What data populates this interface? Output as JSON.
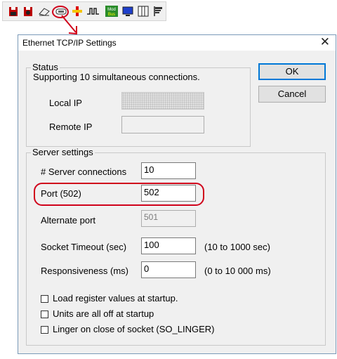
{
  "toolbar": {
    "icons": [
      "save-icon",
      "open-icon",
      "eraser-icon",
      "ethernet-port-icon",
      "add-device-icon",
      "signal-icon",
      "modbus-icon",
      "monitor-icon",
      "columns-icon",
      "flag-icon"
    ],
    "modbus_badge_text": "Mod Bus"
  },
  "dialog": {
    "title": "Ethernet TCP/IP Settings",
    "close_glyph": "✕",
    "ok_label": "OK",
    "cancel_label": "Cancel",
    "status": {
      "legend": "Status",
      "message": "Supporting 10 simultaneous connections.",
      "local_ip_label": "Local IP",
      "remote_ip_label": "Remote IP"
    },
    "server": {
      "legend": "Server settings",
      "connections_label": "# Server connections",
      "connections_value": "10",
      "port_label": "Port (502)",
      "port_value": "502",
      "alt_port_label": "Alternate port",
      "alt_port_value": "501",
      "timeout_label": "Socket Timeout (sec)",
      "timeout_value": "100",
      "timeout_range": "(10 to 1000 sec)",
      "responsiveness_label": "Responsiveness (ms)",
      "responsiveness_value": "0",
      "responsiveness_range": "(0 to 10 000 ms)"
    },
    "options": [
      {
        "label": "Load register values at startup.",
        "checked": false
      },
      {
        "label": "Units are all off at startup",
        "checked": false
      },
      {
        "label": "Linger on close of socket (SO_LINGER)",
        "checked": false
      }
    ]
  },
  "colors": {
    "highlight": "#d0021b",
    "accent": "#0078d7"
  }
}
